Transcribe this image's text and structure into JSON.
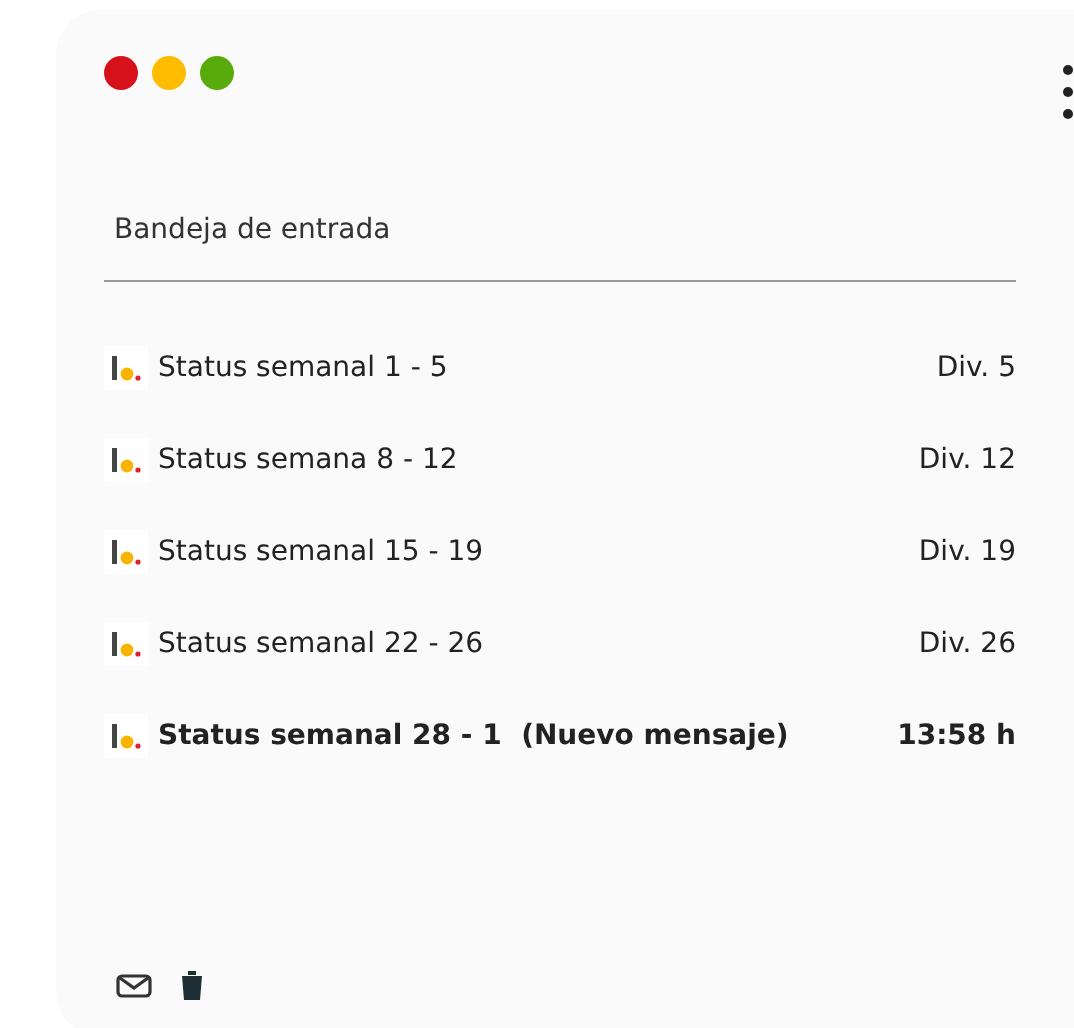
{
  "window": {
    "controls": [
      {
        "color": "#d7111b"
      },
      {
        "color": "#fdbc00"
      },
      {
        "color": "#58ab0b"
      }
    ]
  },
  "inbox": {
    "title": "Bandeja de entrada",
    "messages": [
      {
        "subject": "Status semanal 1 - 5",
        "time": "Div. 5",
        "unread": false
      },
      {
        "subject": "Status semana 8 - 12",
        "time": "Div. 12",
        "unread": false
      },
      {
        "subject": "Status semanal 15 - 19",
        "time": "Div. 19",
        "unread": false
      },
      {
        "subject": "Status semanal 22 - 26",
        "time": "Div. 26",
        "unread": false
      },
      {
        "subject": "Status semanal 28 - 1  (Nuevo mensaje)",
        "time": "13:58 h",
        "unread": true
      }
    ]
  }
}
